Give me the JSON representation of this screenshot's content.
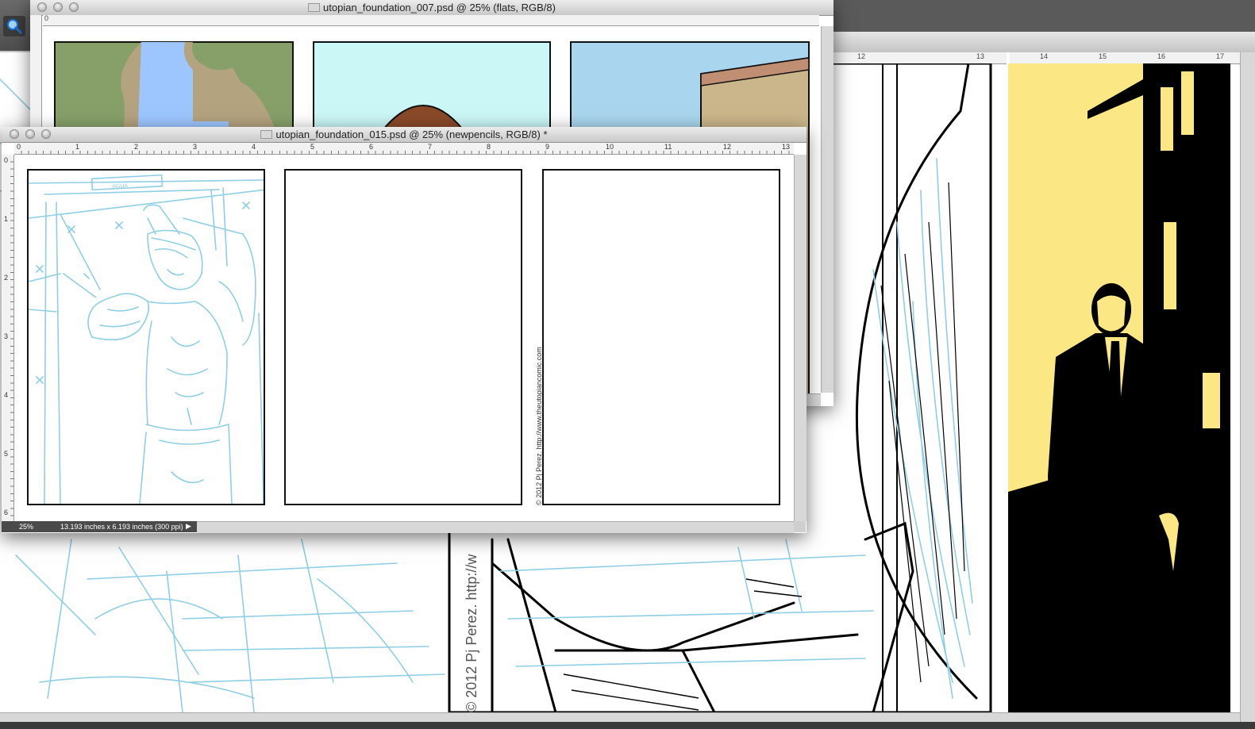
{
  "app": {
    "tool_icon": "magnifier-icon"
  },
  "windows": {
    "back_center": {
      "ruler_labels": [
        "12",
        "13"
      ]
    },
    "back_right": {
      "ruler_labels": [
        "14",
        "15",
        "16",
        "17"
      ]
    },
    "flats": {
      "title": "utopian_foundation_007.psd @ 25% (flats, RGB/8)",
      "ruler_top_label": "0"
    },
    "pencils": {
      "title": "utopian_foundation_015.psd @ 25% (newpencils, RGB/8) *",
      "ruler_h_labels": [
        "0",
        "1",
        "2",
        "3",
        "4",
        "5",
        "6",
        "7",
        "8",
        "9",
        "10",
        "11",
        "12",
        "13"
      ],
      "ruler_v_labels": [
        "0",
        "1",
        "2",
        "3",
        "4",
        "5",
        "6"
      ],
      "sketch_label": "AGUA",
      "copyright_vertical": "© 2012 Pj Perez. http://www.theutopiancomic.com",
      "zoom": "25%",
      "doc_info": "13.193 inches x 6.193 inches (300 ppi)"
    }
  },
  "background_art": {
    "copyright_fragment": "© 2012 Pj Perez. http://w"
  },
  "colors": {
    "pencil_blue": "#8fcfe6",
    "yellow_panel": "#fbe885",
    "flats_green": "#87a06a",
    "flats_sky": "#cbf7f7"
  }
}
